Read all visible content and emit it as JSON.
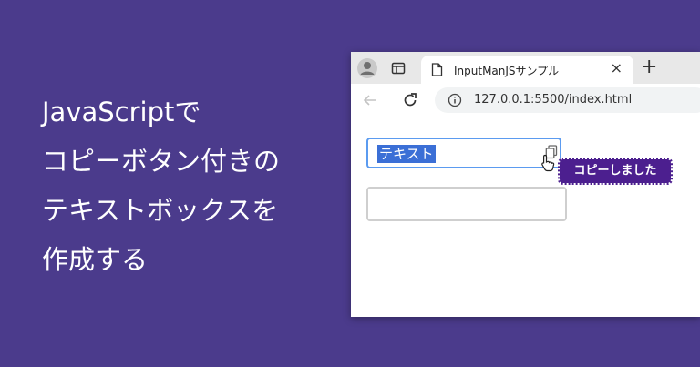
{
  "headline": {
    "lines": [
      "JavaScriptで",
      "コピーボタン付きの",
      "テキストボックスを",
      "作成する"
    ]
  },
  "browser": {
    "tab_title": "InputManJSサンプル",
    "tab_close": "×",
    "new_tab": "+",
    "address": "127.0.0.1:5500/index.html",
    "icons": [
      "profile-icon",
      "tab-actions-icon",
      "document-icon",
      "back-arrow-icon",
      "reload-icon",
      "site-info-icon",
      "copy-icon",
      "hand-cursor-icon"
    ]
  },
  "page": {
    "input1_value": "テキスト",
    "tooltip": "コピーしました",
    "input2_value": ""
  },
  "colors": {
    "background": "#4b3b8c",
    "tooltip_bg": "#4c1f8f",
    "focus_border": "#5b9bf0",
    "selection": "#3b6fd6"
  }
}
